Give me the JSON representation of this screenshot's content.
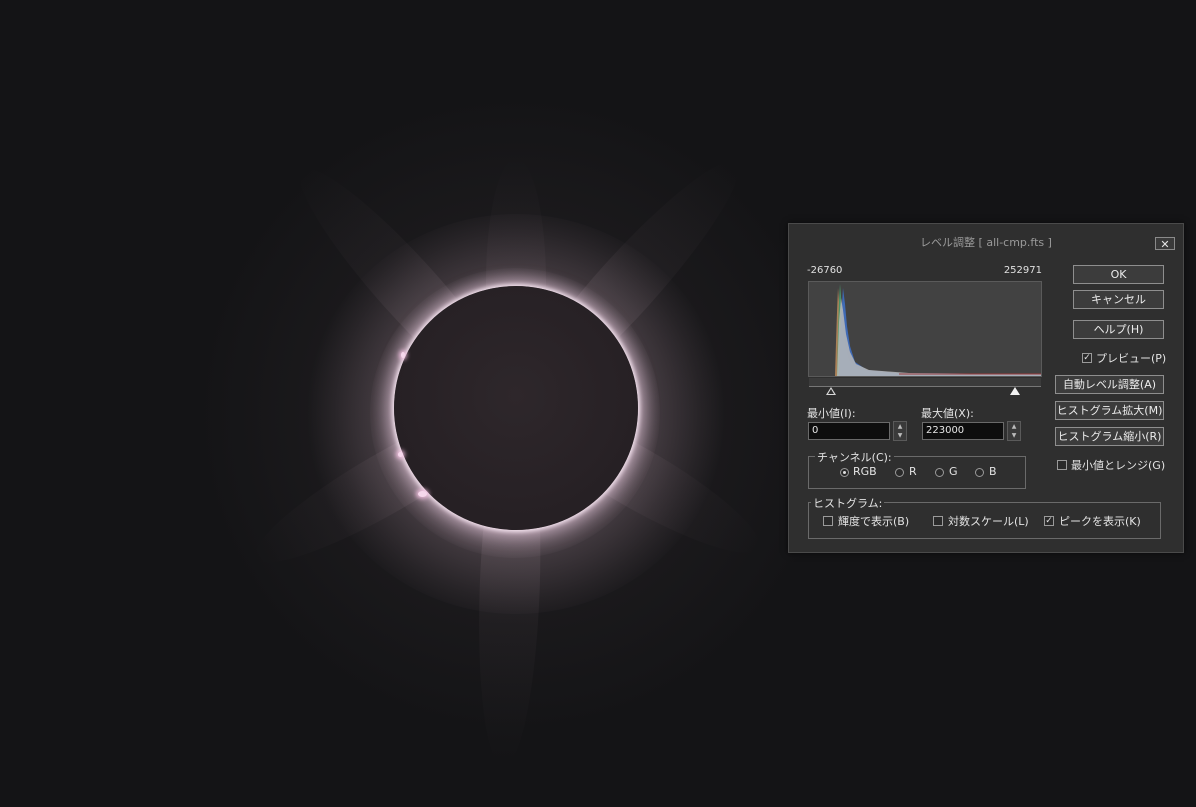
{
  "dialog": {
    "title": "レベル調整 [ all-cmp.fts ]",
    "close_glyph": "✕",
    "histogram": {
      "min_label": "-26760",
      "max_label": "252971"
    },
    "min_value": {
      "label": "最小値(I):",
      "value": "0"
    },
    "max_value": {
      "label": "最大値(X):",
      "value": "223000"
    },
    "channel": {
      "title": "チャンネル(C):",
      "options": [
        "RGB",
        "R",
        "G",
        "B"
      ],
      "selected": "RGB"
    },
    "histogram_group": {
      "title": "ヒストグラム:",
      "luminance": "輝度で表示(B)",
      "log_scale": "対数スケール(L)",
      "show_peak": "ピークを表示(K)"
    },
    "buttons": {
      "ok": "OK",
      "cancel": "キャンセル",
      "help": "ヘルプ(H)",
      "auto_level": "自動レベル調整(A)",
      "hist_expand": "ヒストグラム拡大(M)",
      "hist_shrink": "ヒストグラム縮小(R)"
    },
    "preview": {
      "label": "プレビュー(P)",
      "checked": true
    },
    "min_and_range": {
      "label": "最小値とレンジ(G)",
      "checked": false
    },
    "checks": {
      "luminance": false,
      "log_scale": false,
      "show_peak": true
    },
    "check_glyph": "✓",
    "spin_up": "▲",
    "spin_down": "▼"
  }
}
